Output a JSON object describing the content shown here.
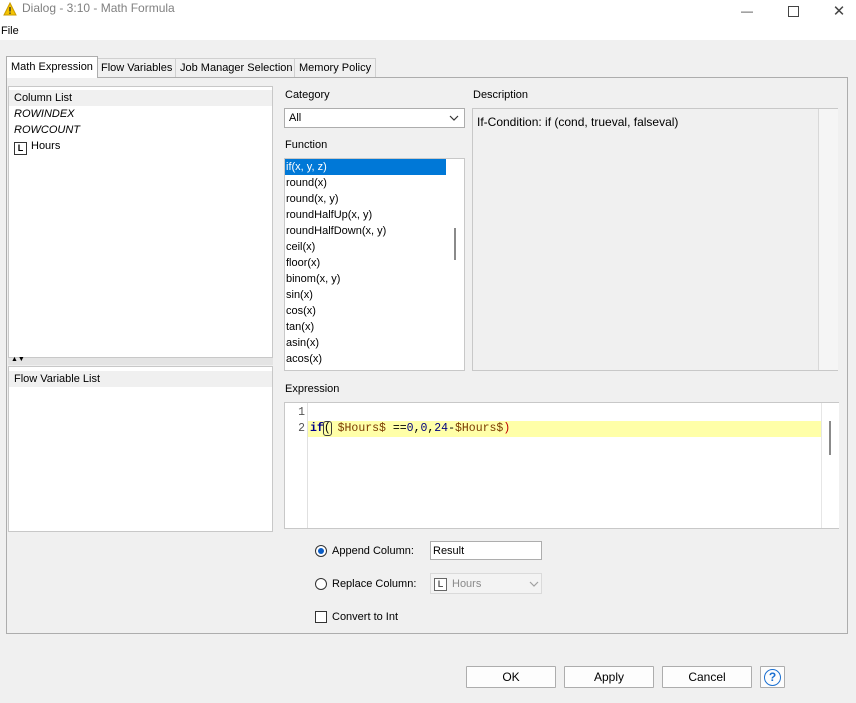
{
  "window": {
    "title": "Dialog - 3:10 - Math Formula",
    "icon": "warning-triangle-icon",
    "controls": [
      "minimize-icon",
      "maximize-icon",
      "close-icon"
    ]
  },
  "menu": {
    "file": "File"
  },
  "tabs": [
    {
      "label": "Math Expression",
      "active": true
    },
    {
      "label": "Flow Variables",
      "active": false
    },
    {
      "label": "Job Manager Selection",
      "active": false
    },
    {
      "label": "Memory Policy",
      "active": false
    }
  ],
  "column_list": {
    "header": "Column List",
    "items": [
      {
        "label": "ROWINDEX",
        "type_icon": ""
      },
      {
        "label": "ROWCOUNT",
        "type_icon": ""
      },
      {
        "label": "Hours",
        "type_icon": "L"
      }
    ]
  },
  "flow_variable_list": {
    "header": "Flow Variable List"
  },
  "category": {
    "label": "Category",
    "value": "All"
  },
  "function": {
    "label": "Function",
    "items": [
      "if(x, y, z)",
      "round(x)",
      "round(x, y)",
      "roundHalfUp(x, y)",
      "roundHalfDown(x, y)",
      "ceil(x)",
      "floor(x)",
      "binom(x, y)",
      "sin(x)",
      "cos(x)",
      "tan(x)",
      "asin(x)",
      "acos(x)"
    ],
    "selected_index": 0
  },
  "description": {
    "label": "Description",
    "text": "If-Condition: if (cond, trueval, falseval)"
  },
  "expression": {
    "label": "Expression",
    "line_numbers": [
      "1",
      "2"
    ],
    "line1": "",
    "line2": {
      "fn": "if",
      "open_paren": "(",
      "space": " ",
      "var1": "$Hours$",
      "op": " ==",
      "n1": "0",
      "c1": ",",
      "n2": "0",
      "c2": ",",
      "n3": "24",
      "minus": "-",
      "var2": "$Hours$",
      "close_paren": ")"
    }
  },
  "options": {
    "append_label": "Append Column:",
    "append_value": "Result",
    "append_selected": true,
    "replace_label": "Replace Column:",
    "replace_value": "Hours",
    "replace_type_icon": "L",
    "convert_label": "Convert to Int",
    "convert_checked": false
  },
  "buttons": {
    "ok": "OK",
    "apply": "Apply",
    "cancel": "Cancel",
    "help_icon": "help-icon",
    "help": "?"
  },
  "colors": {
    "selection": "#0078d7",
    "current_line": "#ffffa8",
    "keyword": "#00008b",
    "variable": "#7a3a00",
    "number": "#00007f",
    "radio_dot": "#0a5cc5"
  }
}
